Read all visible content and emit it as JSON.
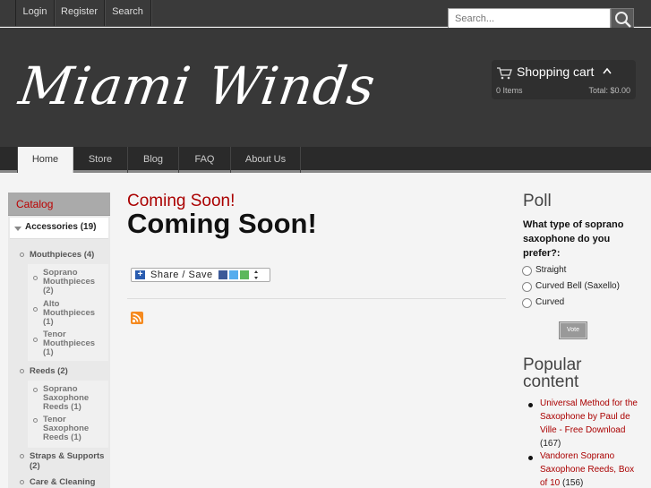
{
  "topbar": {
    "links": [
      "Login",
      "Register",
      "Search"
    ],
    "search_placeholder": "Search...",
    "search_icon": "magnifier-icon"
  },
  "header": {
    "logo_text": "Miami Winds",
    "cart": {
      "title": "Shopping cart",
      "items": "0 Items",
      "total": "Total: $0.00",
      "icon": "cart-icon"
    }
  },
  "nav": {
    "items": [
      "Home",
      "Store",
      "Blog",
      "FAQ",
      "About Us"
    ],
    "active": "Home"
  },
  "sidebar": {
    "heading": "Catalog",
    "accessories": "Accessories (19)",
    "mouthpieces": "Mouthpieces (4)",
    "soprano_mp": "Soprano Mouthpieces (2)",
    "alto_mp": "Alto Mouthpieces (1)",
    "tenor_mp": "Tenor Mouthpieces (1)",
    "reeds": "Reeds (2)",
    "soprano_reeds": "Soprano Saxophone Reeds (1)",
    "tenor_reeds": "Tenor Saxophone Reeds (1)",
    "straps": "Straps & Supports (2)",
    "care": "Care & Cleaning"
  },
  "main": {
    "subtitle": "Coming Soon!",
    "title": "Coming Soon!",
    "share_label": "Share / Save"
  },
  "poll": {
    "title": "Poll",
    "question": "What type of soprano saxophone do you prefer?:",
    "options": [
      "Straight",
      "Curved Bell (Saxello)",
      "Curved"
    ],
    "vote_label": "Vote"
  },
  "popular": {
    "title": "Popular content",
    "items": [
      {
        "text": "Universal Method for the Saxophone by Paul de Ville - Free Download",
        "count": "(167)"
      },
      {
        "text": "Vandoren Soprano Saxophone Reeds, Box of 10",
        "count": "(156)"
      }
    ]
  },
  "colors": {
    "accent_red": "#aa0000",
    "header_bg": "#383838",
    "rss_orange": "#f58a1f"
  }
}
